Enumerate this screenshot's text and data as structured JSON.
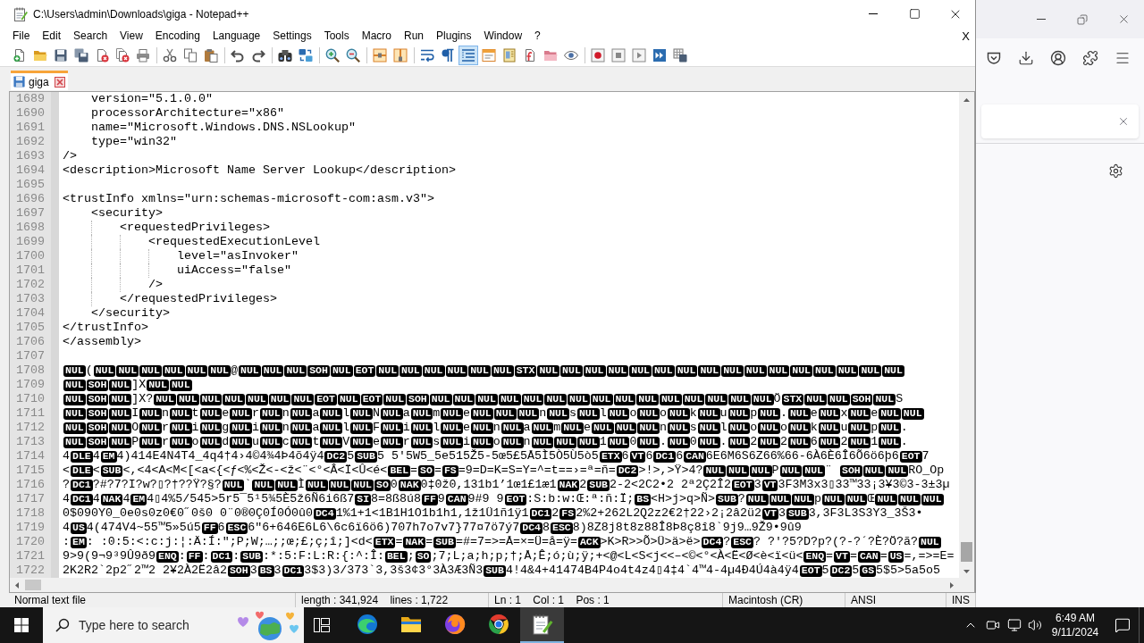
{
  "window": {
    "title": "C:\\Users\\admin\\Downloads\\giga - Notepad++"
  },
  "menu_bar": {
    "items": [
      "File",
      "Edit",
      "Search",
      "View",
      "Encoding",
      "Language",
      "Settings",
      "Tools",
      "Macro",
      "Run",
      "Plugins",
      "Window",
      "?"
    ],
    "close": "X"
  },
  "toolbar": {
    "groups": [
      [
        {
          "selected": false
        },
        {
          "selected": false
        },
        {
          "selected": false
        },
        {
          "selected": false
        },
        {
          "selected": false
        },
        {
          "selected": false
        },
        {
          "selected": false
        }
      ],
      [
        {
          "selected": false
        },
        {
          "selected": false
        },
        {
          "selected": false
        }
      ],
      [
        {
          "selected": false
        },
        {
          "selected": false
        }
      ],
      [
        {
          "selected": false
        },
        {
          "selected": false
        }
      ],
      [
        {
          "selected": false
        },
        {
          "selected": false
        }
      ],
      [
        {
          "selected": false
        },
        {
          "selected": false
        }
      ],
      [
        {
          "selected": false
        },
        {
          "selected": false
        },
        {
          "selected": true
        },
        {
          "selected": false
        },
        {
          "selected": false
        },
        {
          "selected": false
        },
        {
          "selected": false
        },
        {
          "selected": false
        }
      ],
      [
        {
          "selected": false
        },
        {
          "selected": false
        },
        {
          "selected": false
        },
        {
          "selected": false
        },
        {
          "selected": false
        }
      ]
    ]
  },
  "tabs": [
    {
      "label": "giga",
      "selected": true
    }
  ],
  "editor": {
    "lines": [
      {
        "number": "1689",
        "text": "    version=\"5.1.0.0\""
      },
      {
        "number": "1690",
        "text": "    processorArchitecture=\"x86\""
      },
      {
        "number": "1691",
        "text": "    name=\"Microsoft.Windows.DNS.NSLookup\""
      },
      {
        "number": "1692",
        "text": "    type=\"win32\""
      },
      {
        "number": "1693",
        "text": "/>"
      },
      {
        "number": "1694",
        "text": "<description>Microsoft Name Server Lookup</description>"
      },
      {
        "number": "1695"
      },
      {
        "number": "1696",
        "text": "<trustInfo xmlns=\"urn:schemas-microsoft-com:asm.v3\">"
      },
      {
        "number": "1697",
        "text": "    <security>"
      },
      {
        "number": "1698",
        "text": "        <requestedPrivileges>"
      },
      {
        "number": "1699",
        "text": "            <requestedExecutionLevel"
      },
      {
        "number": "1700",
        "text": "                level=\"asInvoker\""
      },
      {
        "number": "1701",
        "text": "                uiAccess=\"false\""
      },
      {
        "number": "1702",
        "text": "            />"
      },
      {
        "number": "1703",
        "text": "        </requestedPrivileges>"
      },
      {
        "number": "1704",
        "text": "    </security>"
      },
      {
        "number": "1705",
        "text": "</trustInfo>"
      },
      {
        "number": "1706",
        "text": "</assembly>"
      },
      {
        "number": "1707"
      },
      {
        "number": "1708",
        "segments": [
          {
            "kind": "ctrl",
            "text": "NUL"
          },
          {
            "kind": "text",
            "text": "("
          },
          {
            "kind": "ctrl",
            "text": "NUL"
          },
          {
            "kind": "ctrl",
            "text": "NUL"
          },
          {
            "kind": "ctrl",
            "text": "NUL"
          },
          {
            "kind": "ctrl",
            "text": "NUL"
          },
          {
            "kind": "ctrl",
            "text": "NUL"
          },
          {
            "kind": "ctrl",
            "text": "NUL"
          },
          {
            "kind": "text",
            "text": "@"
          },
          {
            "kind": "ctrl",
            "text": "NUL"
          },
          {
            "kind": "ctrl",
            "text": "NUL"
          },
          {
            "kind": "ctrl",
            "text": "NUL"
          },
          {
            "kind": "ctrl",
            "text": "SOH"
          },
          {
            "kind": "ctrl",
            "text": "NUL"
          },
          {
            "kind": "ctrl",
            "text": "EOT"
          },
          {
            "kind": "ctrl",
            "text": "NUL"
          },
          {
            "kind": "ctrl",
            "text": "NUL"
          },
          {
            "kind": "ctrl",
            "text": "NUL"
          },
          {
            "kind": "ctrl",
            "text": "NUL"
          },
          {
            "kind": "ctrl",
            "text": "NUL"
          },
          {
            "kind": "ctrl",
            "text": "NUL"
          },
          {
            "kind": "ctrl",
            "text": "STX"
          },
          {
            "kind": "ctrl",
            "text": "NUL"
          },
          {
            "kind": "ctrl",
            "text": "NUL"
          },
          {
            "kind": "ctrl",
            "text": "NUL"
          },
          {
            "kind": "ctrl",
            "text": "NUL"
          },
          {
            "kind": "ctrl",
            "text": "NUL"
          },
          {
            "kind": "ctrl",
            "text": "NUL"
          },
          {
            "kind": "ctrl",
            "text": "NUL"
          },
          {
            "kind": "ctrl",
            "text": "NUL"
          },
          {
            "kind": "ctrl",
            "text": "NUL"
          },
          {
            "kind": "ctrl",
            "text": "NUL"
          },
          {
            "kind": "ctrl",
            "text": "NUL"
          },
          {
            "kind": "ctrl",
            "text": "NUL"
          },
          {
            "kind": "ctrl",
            "text": "NUL"
          },
          {
            "kind": "ctrl",
            "text": "NUL"
          },
          {
            "kind": "ctrl",
            "text": "NUL"
          },
          {
            "kind": "ctrl",
            "text": "NUL"
          }
        ]
      },
      {
        "number": "1709",
        "segments": [
          {
            "kind": "ctrl",
            "text": "NUL"
          },
          {
            "kind": "ctrl",
            "text": "SOH"
          },
          {
            "kind": "ctrl",
            "text": "NUL"
          },
          {
            "kind": "text",
            "text": "]X"
          },
          {
            "kind": "ctrl",
            "text": "NUL"
          },
          {
            "kind": "ctrl",
            "text": "NUL"
          }
        ]
      },
      {
        "number": "1710",
        "segments": [
          {
            "kind": "ctrl",
            "text": "NUL"
          },
          {
            "kind": "ctrl",
            "text": "SOH"
          },
          {
            "kind": "ctrl",
            "text": "NUL"
          },
          {
            "kind": "text",
            "text": "]X?"
          },
          {
            "kind": "ctrl",
            "text": "NUL"
          },
          {
            "kind": "ctrl",
            "text": "NUL"
          },
          {
            "kind": "ctrl",
            "text": "NUL"
          },
          {
            "kind": "ctrl",
            "text": "NUL"
          },
          {
            "kind": "ctrl",
            "text": "NUL"
          },
          {
            "kind": "ctrl",
            "text": "NUL"
          },
          {
            "kind": "ctrl",
            "text": "NUL"
          },
          {
            "kind": "ctrl",
            "text": "EOT"
          },
          {
            "kind": "ctrl",
            "text": "NUL"
          },
          {
            "kind": "ctrl",
            "text": "EOT"
          },
          {
            "kind": "ctrl",
            "text": "NUL"
          },
          {
            "kind": "ctrl",
            "text": "SOH"
          },
          {
            "kind": "ctrl",
            "text": "NUL"
          },
          {
            "kind": "ctrl",
            "text": "NUL"
          },
          {
            "kind": "ctrl",
            "text": "NUL"
          },
          {
            "kind": "ctrl",
            "text": "NUL"
          },
          {
            "kind": "ctrl",
            "text": "NUL"
          },
          {
            "kind": "ctrl",
            "text": "NUL"
          },
          {
            "kind": "ctrl",
            "text": "NUL"
          },
          {
            "kind": "ctrl",
            "text": "NUL"
          },
          {
            "kind": "ctrl",
            "text": "NUL"
          },
          {
            "kind": "ctrl",
            "text": "NUL"
          },
          {
            "kind": "ctrl",
            "text": "NUL"
          },
          {
            "kind": "ctrl",
            "text": "NUL"
          },
          {
            "kind": "ctrl",
            "text": "NUL"
          },
          {
            "kind": "ctrl",
            "text": "NUL"
          },
          {
            "kind": "ctrl",
            "text": "NUL"
          },
          {
            "kind": "text",
            "text": "Ö"
          },
          {
            "kind": "ctrl",
            "text": "STX"
          },
          {
            "kind": "ctrl",
            "text": "NUL"
          },
          {
            "kind": "ctrl",
            "text": "NUL"
          },
          {
            "kind": "ctrl",
            "text": "SOH"
          },
          {
            "kind": "ctrl",
            "text": "NUL"
          },
          {
            "kind": "text",
            "text": "S"
          }
        ]
      },
      {
        "number": "1711",
        "segments": [
          {
            "kind": "ctrl",
            "text": "NUL"
          },
          {
            "kind": "ctrl",
            "text": "SOH"
          },
          {
            "kind": "ctrl",
            "text": "NUL"
          },
          {
            "kind": "text",
            "text": "I"
          },
          {
            "kind": "ctrl",
            "text": "NUL"
          },
          {
            "kind": "text",
            "text": "n"
          },
          {
            "kind": "ctrl",
            "text": "NUL"
          },
          {
            "kind": "text",
            "text": "t"
          },
          {
            "kind": "ctrl",
            "text": "NUL"
          },
          {
            "kind": "text",
            "text": "e"
          },
          {
            "kind": "ctrl",
            "text": "NUL"
          },
          {
            "kind": "text",
            "text": "r"
          },
          {
            "kind": "ctrl",
            "text": "NUL"
          },
          {
            "kind": "text",
            "text": "n"
          },
          {
            "kind": "ctrl",
            "text": "NUL"
          },
          {
            "kind": "text",
            "text": "a"
          },
          {
            "kind": "ctrl",
            "text": "NUL"
          },
          {
            "kind": "text",
            "text": "l"
          },
          {
            "kind": "ctrl",
            "text": "NUL"
          },
          {
            "kind": "text",
            "text": "N"
          },
          {
            "kind": "ctrl",
            "text": "NUL"
          },
          {
            "kind": "text",
            "text": "a"
          },
          {
            "kind": "ctrl",
            "text": "NUL"
          },
          {
            "kind": "text",
            "text": "m"
          },
          {
            "kind": "ctrl",
            "text": "NUL"
          },
          {
            "kind": "text",
            "text": "e"
          },
          {
            "kind": "ctrl",
            "text": "NUL"
          },
          {
            "kind": "ctrl",
            "text": "NUL"
          },
          {
            "kind": "ctrl",
            "text": "NUL"
          },
          {
            "kind": "text",
            "text": "n"
          },
          {
            "kind": "ctrl",
            "text": "NUL"
          },
          {
            "kind": "text",
            "text": "s"
          },
          {
            "kind": "ctrl",
            "text": "NUL"
          },
          {
            "kind": "text",
            "text": "l"
          },
          {
            "kind": "ctrl",
            "text": "NUL"
          },
          {
            "kind": "text",
            "text": "o"
          },
          {
            "kind": "ctrl",
            "text": "NUL"
          },
          {
            "kind": "text",
            "text": "o"
          },
          {
            "kind": "ctrl",
            "text": "NUL"
          },
          {
            "kind": "text",
            "text": "k"
          },
          {
            "kind": "ctrl",
            "text": "NUL"
          },
          {
            "kind": "text",
            "text": "u"
          },
          {
            "kind": "ctrl",
            "text": "NUL"
          },
          {
            "kind": "text",
            "text": "p"
          },
          {
            "kind": "ctrl",
            "text": "NUL"
          },
          {
            "kind": "text",
            "text": "."
          },
          {
            "kind": "ctrl",
            "text": "NUL"
          },
          {
            "kind": "text",
            "text": "e"
          },
          {
            "kind": "ctrl",
            "text": "NUL"
          },
          {
            "kind": "text",
            "text": "x"
          },
          {
            "kind": "ctrl",
            "text": "NUL"
          },
          {
            "kind": "text",
            "text": "e"
          },
          {
            "kind": "ctrl",
            "text": "NUL"
          },
          {
            "kind": "ctrl",
            "text": "NUL"
          }
        ]
      },
      {
        "number": "1712",
        "segments": [
          {
            "kind": "ctrl",
            "text": "NUL"
          },
          {
            "kind": "ctrl",
            "text": "SOH"
          },
          {
            "kind": "ctrl",
            "text": "NUL"
          },
          {
            "kind": "text",
            "text": "O"
          },
          {
            "kind": "ctrl",
            "text": "NUL"
          },
          {
            "kind": "text",
            "text": "r"
          },
          {
            "kind": "ctrl",
            "text": "NUL"
          },
          {
            "kind": "text",
            "text": "i"
          },
          {
            "kind": "ctrl",
            "text": "NUL"
          },
          {
            "kind": "text",
            "text": "g"
          },
          {
            "kind": "ctrl",
            "text": "NUL"
          },
          {
            "kind": "text",
            "text": "i"
          },
          {
            "kind": "ctrl",
            "text": "NUL"
          },
          {
            "kind": "text",
            "text": "n"
          },
          {
            "kind": "ctrl",
            "text": "NUL"
          },
          {
            "kind": "text",
            "text": "a"
          },
          {
            "kind": "ctrl",
            "text": "NUL"
          },
          {
            "kind": "text",
            "text": "l"
          },
          {
            "kind": "ctrl",
            "text": "NUL"
          },
          {
            "kind": "text",
            "text": "F"
          },
          {
            "kind": "ctrl",
            "text": "NUL"
          },
          {
            "kind": "text",
            "text": "i"
          },
          {
            "kind": "ctrl",
            "text": "NUL"
          },
          {
            "kind": "text",
            "text": "l"
          },
          {
            "kind": "ctrl",
            "text": "NUL"
          },
          {
            "kind": "text",
            "text": "e"
          },
          {
            "kind": "ctrl",
            "text": "NUL"
          },
          {
            "kind": "text",
            "text": "n"
          },
          {
            "kind": "ctrl",
            "text": "NUL"
          },
          {
            "kind": "text",
            "text": "a"
          },
          {
            "kind": "ctrl",
            "text": "NUL"
          },
          {
            "kind": "text",
            "text": "m"
          },
          {
            "kind": "ctrl",
            "text": "NUL"
          },
          {
            "kind": "text",
            "text": "e"
          },
          {
            "kind": "ctrl",
            "text": "NUL"
          },
          {
            "kind": "ctrl",
            "text": "NUL"
          },
          {
            "kind": "ctrl",
            "text": "NUL"
          },
          {
            "kind": "text",
            "text": "n"
          },
          {
            "kind": "ctrl",
            "text": "NUL"
          },
          {
            "kind": "text",
            "text": "s"
          },
          {
            "kind": "ctrl",
            "text": "NUL"
          },
          {
            "kind": "text",
            "text": "l"
          },
          {
            "kind": "ctrl",
            "text": "NUL"
          },
          {
            "kind": "text",
            "text": "o"
          },
          {
            "kind": "ctrl",
            "text": "NUL"
          },
          {
            "kind": "text",
            "text": "o"
          },
          {
            "kind": "ctrl",
            "text": "NUL"
          },
          {
            "kind": "text",
            "text": "k"
          },
          {
            "kind": "ctrl",
            "text": "NUL"
          },
          {
            "kind": "text",
            "text": "u"
          },
          {
            "kind": "ctrl",
            "text": "NUL"
          },
          {
            "kind": "text",
            "text": "p"
          },
          {
            "kind": "ctrl",
            "text": "NUL"
          },
          {
            "kind": "text",
            "text": "."
          }
        ]
      },
      {
        "number": "1713",
        "segments": [
          {
            "kind": "ctrl",
            "text": "NUL"
          },
          {
            "kind": "ctrl",
            "text": "SOH"
          },
          {
            "kind": "ctrl",
            "text": "NUL"
          },
          {
            "kind": "text",
            "text": "P"
          },
          {
            "kind": "ctrl",
            "text": "NUL"
          },
          {
            "kind": "text",
            "text": "r"
          },
          {
            "kind": "ctrl",
            "text": "NUL"
          },
          {
            "kind": "text",
            "text": "o"
          },
          {
            "kind": "ctrl",
            "text": "NUL"
          },
          {
            "kind": "text",
            "text": "d"
          },
          {
            "kind": "ctrl",
            "text": "NUL"
          },
          {
            "kind": "text",
            "text": "u"
          },
          {
            "kind": "ctrl",
            "text": "NUL"
          },
          {
            "kind": "text",
            "text": "c"
          },
          {
            "kind": "ctrl",
            "text": "NUL"
          },
          {
            "kind": "text",
            "text": "t"
          },
          {
            "kind": "ctrl",
            "text": "NUL"
          },
          {
            "kind": "text",
            "text": "V"
          },
          {
            "kind": "ctrl",
            "text": "NUL"
          },
          {
            "kind": "text",
            "text": "e"
          },
          {
            "kind": "ctrl",
            "text": "NUL"
          },
          {
            "kind": "text",
            "text": "r"
          },
          {
            "kind": "ctrl",
            "text": "NUL"
          },
          {
            "kind": "text",
            "text": "s"
          },
          {
            "kind": "ctrl",
            "text": "NUL"
          },
          {
            "kind": "text",
            "text": "i"
          },
          {
            "kind": "ctrl",
            "text": "NUL"
          },
          {
            "kind": "text",
            "text": "o"
          },
          {
            "kind": "ctrl",
            "text": "NUL"
          },
          {
            "kind": "text",
            "text": "n"
          },
          {
            "kind": "ctrl",
            "text": "NUL"
          },
          {
            "kind": "ctrl",
            "text": "NUL"
          },
          {
            "kind": "ctrl",
            "text": "NUL"
          },
          {
            "kind": "text",
            "text": "1"
          },
          {
            "kind": "ctrl",
            "text": "NUL"
          },
          {
            "kind": "text",
            "text": "0"
          },
          {
            "kind": "ctrl",
            "text": "NUL"
          },
          {
            "kind": "text",
            "text": "."
          },
          {
            "kind": "ctrl",
            "text": "NUL"
          },
          {
            "kind": "text",
            "text": "0"
          },
          {
            "kind": "ctrl",
            "text": "NUL"
          },
          {
            "kind": "text",
            "text": "."
          },
          {
            "kind": "ctrl",
            "text": "NUL"
          },
          {
            "kind": "text",
            "text": "2"
          },
          {
            "kind": "ctrl",
            "text": "NUL"
          },
          {
            "kind": "text",
            "text": "2"
          },
          {
            "kind": "ctrl",
            "text": "NUL"
          },
          {
            "kind": "text",
            "text": "6"
          },
          {
            "kind": "ctrl",
            "text": "NUL"
          },
          {
            "kind": "text",
            "text": "2"
          },
          {
            "kind": "ctrl",
            "text": "NUL"
          },
          {
            "kind": "text",
            "text": "1"
          },
          {
            "kind": "ctrl",
            "text": "NUL"
          },
          {
            "kind": "text",
            "text": "."
          }
        ]
      },
      {
        "number": "1714",
        "segments": [
          {
            "kind": "text",
            "text": "4"
          },
          {
            "kind": "ctrl",
            "text": "DLE"
          },
          {
            "kind": "text",
            "text": "4"
          },
          {
            "kind": "ctrl",
            "text": "EM"
          },
          {
            "kind": "text",
            "text": "4)414E4N4T4_4q4†4›4©4¾4Þ4õ4ÿ4"
          },
          {
            "kind": "ctrl",
            "text": "DC2"
          },
          {
            "kind": "text",
            "text": "5"
          },
          {
            "kind": "ctrl",
            "text": "SUB"
          },
          {
            "kind": "text",
            "text": "5 5'5W5_5e515Ž5-5œ5£5Å5Ì5Ò5Ù5ò5"
          },
          {
            "kind": "ctrl",
            "text": "ETX"
          },
          {
            "kind": "text",
            "text": "6"
          },
          {
            "kind": "ctrl",
            "text": "VT"
          },
          {
            "kind": "text",
            "text": "6"
          },
          {
            "kind": "ctrl",
            "text": "DC1"
          },
          {
            "kind": "text",
            "text": "6"
          },
          {
            "kind": "ctrl",
            "text": "CAN"
          },
          {
            "kind": "text",
            "text": "6E6M6S6Z66%66-6À6È6Î6Õ6ö6þ6"
          },
          {
            "kind": "ctrl",
            "text": "EOT"
          },
          {
            "kind": "text",
            "text": "7"
          }
        ]
      },
      {
        "number": "1715",
        "segments": [
          {
            "kind": "text",
            "text": "<"
          },
          {
            "kind": "ctrl",
            "text": "DLE"
          },
          {
            "kind": "text",
            "text": "<"
          },
          {
            "kind": "ctrl",
            "text": "SUB"
          },
          {
            "kind": "text",
            "text": "<,<4<A<M<[<a<{<ƒ<%<Ž<-<ž<¨<°<Â<Ï<Û<é<"
          },
          {
            "kind": "ctrl",
            "text": "BEL"
          },
          {
            "kind": "text",
            "text": "="
          },
          {
            "kind": "ctrl",
            "text": "SO"
          },
          {
            "kind": "text",
            "text": "="
          },
          {
            "kind": "ctrl",
            "text": "FS"
          },
          {
            "kind": "text",
            "text": "=9=D=K=S=Y=^=t==›=ª=ñ="
          },
          {
            "kind": "ctrl",
            "text": "DC2"
          },
          {
            "kind": "text",
            "text": ">!>,>Ÿ>4?"
          },
          {
            "kind": "ctrl",
            "text": "NUL"
          },
          {
            "kind": "ctrl",
            "text": "NUL"
          },
          {
            "kind": "ctrl",
            "text": "NUL"
          },
          {
            "kind": "text",
            "text": "P"
          },
          {
            "kind": "ctrl",
            "text": "NUL"
          },
          {
            "kind": "ctrl",
            "text": "NUL"
          },
          {
            "kind": "text",
            "text": "¨ "
          },
          {
            "kind": "ctrl",
            "text": "SOH"
          },
          {
            "kind": "ctrl",
            "text": "NUL"
          },
          {
            "kind": "ctrl",
            "text": "NUL"
          },
          {
            "kind": "text",
            "text": "RO_Op"
          }
        ]
      },
      {
        "number": "1716",
        "segments": [
          {
            "kind": "text",
            "text": "?"
          },
          {
            "kind": "ctrl",
            "text": "DC1"
          },
          {
            "kind": "text",
            "text": "?#?7?I?w?▯?†??Ÿ?§?"
          },
          {
            "kind": "ctrl",
            "text": "NUL"
          },
          {
            "kind": "text",
            "text": "`"
          },
          {
            "kind": "ctrl",
            "text": "NUL"
          },
          {
            "kind": "ctrl",
            "text": "NUL"
          },
          {
            "kind": "text",
            "text": "Ì"
          },
          {
            "kind": "ctrl",
            "text": "NUL"
          },
          {
            "kind": "ctrl",
            "text": "NUL"
          },
          {
            "kind": "ctrl",
            "text": "NUL"
          },
          {
            "kind": "ctrl",
            "text": "SO"
          },
          {
            "kind": "text",
            "text": "0"
          },
          {
            "kind": "ctrl",
            "text": "NAK"
          },
          {
            "kind": "text",
            "text": "0‡0ž0,131b1’1œ1£1æ1"
          },
          {
            "kind": "ctrl",
            "text": "NAK"
          },
          {
            "kind": "text",
            "text": "2"
          },
          {
            "kind": "ctrl",
            "text": "SUB"
          },
          {
            "kind": "text",
            "text": "2-2<2C2•2 2ª2Ç2Î2"
          },
          {
            "kind": "ctrl",
            "text": "EOT"
          },
          {
            "kind": "text",
            "text": "3"
          },
          {
            "kind": "ctrl",
            "text": "VT"
          },
          {
            "kind": "text",
            "text": "3F3M3x3▯33™33¡3¥3©3-3±3µ"
          }
        ]
      },
      {
        "number": "1717",
        "segments": [
          {
            "kind": "text",
            "text": "4"
          },
          {
            "kind": "ctrl",
            "text": "DC1"
          },
          {
            "kind": "text",
            "text": "4"
          },
          {
            "kind": "ctrl",
            "text": "NAK"
          },
          {
            "kind": "text",
            "text": "4"
          },
          {
            "kind": "ctrl",
            "text": "EM"
          },
          {
            "kind": "text",
            "text": "4▯4%5/545>5r5¯5¹5¾5È5ž6Ñ6i6ß7"
          },
          {
            "kind": "ctrl",
            "text": "SI"
          },
          {
            "kind": "text",
            "text": "8=8ß8ú8"
          },
          {
            "kind": "ctrl",
            "text": "FF"
          },
          {
            "kind": "text",
            "text": "9"
          },
          {
            "kind": "ctrl",
            "text": "CAN"
          },
          {
            "kind": "text",
            "text": "9#9 9"
          },
          {
            "kind": "ctrl",
            "text": "EOT"
          },
          {
            "kind": "text",
            "text": ":S:b:w:Œ:ª:ñ:Ï;"
          },
          {
            "kind": "ctrl",
            "text": "BS"
          },
          {
            "kind": "text",
            "text": "<H>j>q>Ñ>"
          },
          {
            "kind": "ctrl",
            "text": "SUB"
          },
          {
            "kind": "text",
            "text": "?"
          },
          {
            "kind": "ctrl",
            "text": "NUL"
          },
          {
            "kind": "ctrl",
            "text": "NUL"
          },
          {
            "kind": "ctrl",
            "text": "NUL"
          },
          {
            "kind": "text",
            "text": "p"
          },
          {
            "kind": "ctrl",
            "text": "NUL"
          },
          {
            "kind": "ctrl",
            "text": "NUL"
          },
          {
            "kind": "text",
            "text": "Œ"
          },
          {
            "kind": "ctrl",
            "text": "NUL"
          },
          {
            "kind": "ctrl",
            "text": "NUL"
          },
          {
            "kind": "ctrl",
            "text": "NUL"
          }
        ]
      },
      {
        "number": "1718",
        "segments": [
          {
            "kind": "text",
            "text": "0$090Y0_0e0s0z0€0˝0š0 0¨0®0Ç0Í0Ó0û0"
          },
          {
            "kind": "ctrl",
            "text": "DC4"
          },
          {
            "kind": "text",
            "text": "1%1+1<1B1H1O1b1h1,1ž1Ü1ñ1ÿ1"
          },
          {
            "kind": "ctrl",
            "text": "DC1"
          },
          {
            "kind": "text",
            "text": "2"
          },
          {
            "kind": "ctrl",
            "text": "FS"
          },
          {
            "kind": "text",
            "text": "2%2+262L2Q2z2€2†22›2¡2â2ü2"
          },
          {
            "kind": "ctrl",
            "text": "VT"
          },
          {
            "kind": "text",
            "text": "3"
          },
          {
            "kind": "ctrl",
            "text": "SUB"
          },
          {
            "kind": "text",
            "text": "3,3F3L3S3Y3_3Š3•"
          }
        ]
      },
      {
        "number": "1719",
        "segments": [
          {
            "kind": "text",
            "text": "4"
          },
          {
            "kind": "ctrl",
            "text": "US"
          },
          {
            "kind": "text",
            "text": "4(474V4~55™5»5ú5"
          },
          {
            "kind": "ctrl",
            "text": "FF"
          },
          {
            "kind": "text",
            "text": "6"
          },
          {
            "kind": "ctrl",
            "text": "ESC"
          },
          {
            "kind": "text",
            "text": "6\"6+646E6L6\\6c6ï6ö6)707h7o7v7}77¤7ö7ý7"
          },
          {
            "kind": "ctrl",
            "text": "DC4"
          },
          {
            "kind": "text",
            "text": "8"
          },
          {
            "kind": "ctrl",
            "text": "ESC"
          },
          {
            "kind": "text",
            "text": "8)8Z8j8t8z88Î8Þ8ç8î8`9j9…9Ž9•9û9"
          }
        ]
      },
      {
        "number": "1720",
        "segments": [
          {
            "kind": "text",
            "text": ":"
          },
          {
            "kind": "ctrl",
            "text": "EM"
          },
          {
            "kind": "text",
            "text": ": :0:5:<:c:j:¦:Ä:Í:\";P;W;…;;œ;£;ç;î;]<d<"
          },
          {
            "kind": "ctrl",
            "text": "ETX"
          },
          {
            "kind": "text",
            "text": "="
          },
          {
            "kind": "ctrl",
            "text": "NAK"
          },
          {
            "kind": "text",
            "text": "="
          },
          {
            "kind": "ctrl",
            "text": "SUB"
          },
          {
            "kind": "text",
            "text": "=#=7=>=Å=×=Ü=å=ÿ="
          },
          {
            "kind": "ctrl",
            "text": "ACK"
          },
          {
            "kind": "text",
            "text": ">K>R>>Õ>Ü>ä>ë>"
          },
          {
            "kind": "ctrl",
            "text": "DC4"
          },
          {
            "kind": "text",
            "text": "?"
          },
          {
            "kind": "ctrl",
            "text": "ESC"
          },
          {
            "kind": "text",
            "text": "? ?'?5?D?p?(?-?´?È?Ö?ã?"
          },
          {
            "kind": "ctrl",
            "text": "NUL"
          }
        ]
      },
      {
        "number": "1721",
        "segments": [
          {
            "kind": "text",
            "text": "9>9(9¬9³9Û9ð9"
          },
          {
            "kind": "ctrl",
            "text": "ENQ"
          },
          {
            "kind": "text",
            "text": ":"
          },
          {
            "kind": "ctrl",
            "text": "FF"
          },
          {
            "kind": "text",
            "text": ":"
          },
          {
            "kind": "ctrl",
            "text": "DC1"
          },
          {
            "kind": "text",
            "text": ":"
          },
          {
            "kind": "ctrl",
            "text": "SUB"
          },
          {
            "kind": "text",
            "text": ":*:5:F:L:R:{:^:Î:"
          },
          {
            "kind": "ctrl",
            "text": "BEL"
          },
          {
            "kind": "text",
            "text": ";"
          },
          {
            "kind": "ctrl",
            "text": "SO"
          },
          {
            "kind": "text",
            "text": ";7;L;a;h;p;†;Å;Ê;ó;ù;ÿ;+<@<L<S<j<<–<©<°<À<Ë<Ø<è<ï<ü<"
          },
          {
            "kind": "ctrl",
            "text": "ENQ"
          },
          {
            "kind": "text",
            "text": "="
          },
          {
            "kind": "ctrl",
            "text": "VT"
          },
          {
            "kind": "text",
            "text": "="
          },
          {
            "kind": "ctrl",
            "text": "CAN"
          },
          {
            "kind": "text",
            "text": "="
          },
          {
            "kind": "ctrl",
            "text": "US"
          },
          {
            "kind": "text",
            "text": "=,=>=E="
          }
        ]
      },
      {
        "number": "1722",
        "segments": [
          {
            "kind": "text",
            "text": "2K2R2`2p2˝2™2 2¥2À2Ë2â2"
          },
          {
            "kind": "ctrl",
            "text": "SOH"
          },
          {
            "kind": "text",
            "text": "3"
          },
          {
            "kind": "ctrl",
            "text": "BS"
          },
          {
            "kind": "text",
            "text": "3"
          },
          {
            "kind": "ctrl",
            "text": "DC1"
          },
          {
            "kind": "text",
            "text": "3$3)3/373`3,3š3¢3°3À3Æ3Ñ3"
          },
          {
            "kind": "ctrl",
            "text": "SUB"
          },
          {
            "kind": "text",
            "text": "4!4&4+41474B4P4o4t4z4▯4‡4`4™4-4µ4Ð4Ú4à4ÿ4"
          },
          {
            "kind": "ctrl",
            "text": "EOT"
          },
          {
            "kind": "text",
            "text": "5"
          },
          {
            "kind": "ctrl",
            "text": "DC2"
          },
          {
            "kind": "text",
            "text": "5"
          },
          {
            "kind": "ctrl",
            "text": "GS"
          },
          {
            "kind": "text",
            "text": "5$5>5a5o5"
          }
        ]
      }
    ]
  },
  "status_bar": [
    "Normal text file",
    "length : 341,924    lines : 1,722",
    "Ln : 1    Col : 1    Pos : 1",
    "Macintosh (CR)",
    "ANSI",
    "INS"
  ],
  "taskbar": {
    "search": {
      "placeholder": "Type here to search"
    },
    "apps": [
      {
        "selected": false
      },
      {
        "selected": false
      },
      {
        "selected": false
      },
      {
        "selected": false
      },
      {
        "selected": true
      }
    ],
    "clock": {
      "time": "6:49 AM",
      "date": "9/11/2024"
    }
  }
}
